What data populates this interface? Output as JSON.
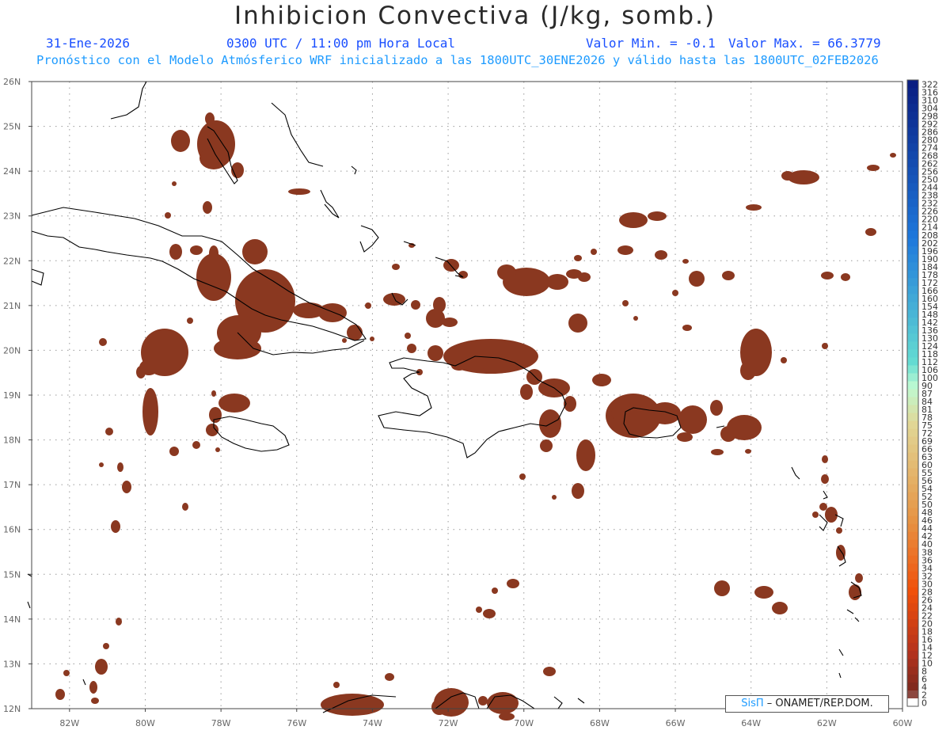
{
  "title": "Inhibicion Convectiva (J/kg, somb.)",
  "header": {
    "date": "31-Ene-2026",
    "time": "0300 UTC / 11:00 pm Hora Local",
    "min_label": "Valor Min. = -0.1",
    "max_label": "Valor Max. = 66.3779",
    "forecast_note": "Pronóstico con el Modelo Atmósferico WRF inicializado a las 1800UTC_30ENE2026 y válido hasta las  1800UTC_02FEB2026"
  },
  "map": {
    "lat_labels": [
      "26N",
      "25N",
      "24N",
      "23N",
      "22N",
      "21N",
      "20N",
      "19N",
      "18N",
      "17N",
      "16N",
      "15N",
      "14N",
      "13N",
      "12N"
    ],
    "lon_labels": [
      "82W",
      "80W",
      "78W",
      "76W",
      "74W",
      "72W",
      "70W",
      "68W",
      "66W",
      "64W",
      "62W",
      "60W"
    ],
    "lat_range": [
      12,
      26
    ],
    "lon_range": [
      -83,
      -60
    ],
    "fill_color": "#8a3820",
    "coast_color": "#000000"
  },
  "colorbar": {
    "labels": [
      "322",
      "316",
      "310",
      "304",
      "298",
      "292",
      "286",
      "280",
      "274",
      "268",
      "262",
      "256",
      "250",
      "244",
      "238",
      "232",
      "226",
      "220",
      "214",
      "208",
      "202",
      "196",
      "190",
      "184",
      "178",
      "172",
      "166",
      "160",
      "154",
      "148",
      "142",
      "136",
      "130",
      "124",
      "118",
      "112",
      "106",
      "100",
      "90",
      "87",
      "84",
      "81",
      "78",
      "75",
      "72",
      "69",
      "66",
      "63",
      "60",
      "55",
      "56",
      "54",
      "52",
      "50",
      "48",
      "46",
      "44",
      "42",
      "40",
      "38",
      "36",
      "34",
      "32",
      "30",
      "28",
      "26",
      "24",
      "22",
      "20",
      "18",
      "16",
      "14",
      "12",
      "10",
      "8",
      "6",
      "4",
      "2",
      "0"
    ]
  },
  "credit": {
    "brand": "SisΠ",
    "text": "– ONAMET/REP.DOM."
  }
}
